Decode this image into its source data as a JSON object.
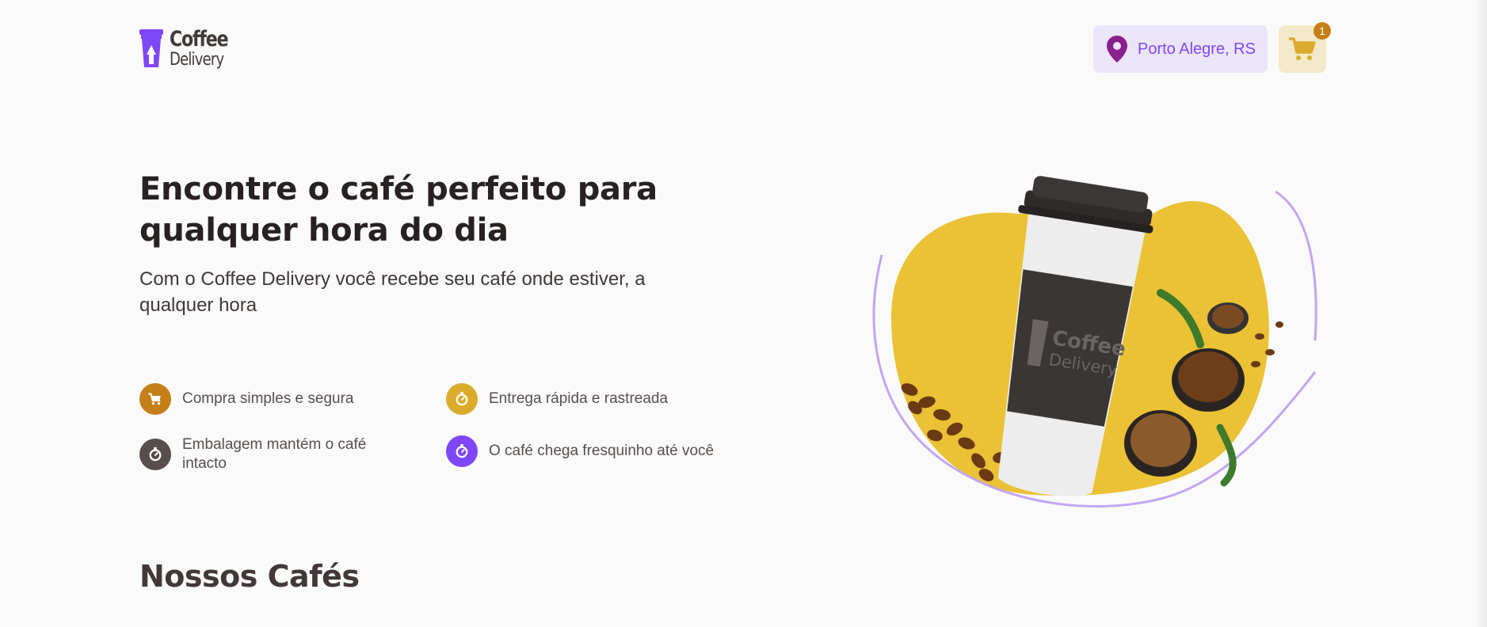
{
  "brand": {
    "name_line1": "Coffee",
    "name_line2": "Delivery",
    "purple": "#8047f8",
    "yellow": "#dbac2c",
    "yellow_dark": "#c47f17",
    "base_text": "#574f4d"
  },
  "header": {
    "location_label": "Porto Alegre, RS",
    "location_icon": "map-pin-icon",
    "cart_icon": "shopping-cart-icon",
    "cart_count": "1"
  },
  "hero": {
    "title_line1": "Encontre o café perfeito para",
    "title_line2": "qualquer hora do dia",
    "subtitle_line1": "Com o Coffee Delivery você recebe seu café onde estiver, a",
    "subtitle_line2": "qualquer hora",
    "features": [
      {
        "label": "Compra simples e segura",
        "icon": "shopping-cart-icon",
        "color": "#c47f17"
      },
      {
        "label": "Entrega rápida e rastreada",
        "icon": "timer-icon",
        "color": "#dbac2c"
      },
      {
        "label_line1": "Embalagem mantém o café",
        "label_line2": "intacto",
        "icon": "timer-icon",
        "color": "#574f4d"
      },
      {
        "label": "O café chega fresquinho até você",
        "icon": "timer-icon",
        "color": "#8047f8"
      }
    ],
    "cup_logo_line1": "Coffee",
    "cup_logo_line2": "Delivery"
  },
  "section": {
    "title": "Nossos Cafés"
  }
}
